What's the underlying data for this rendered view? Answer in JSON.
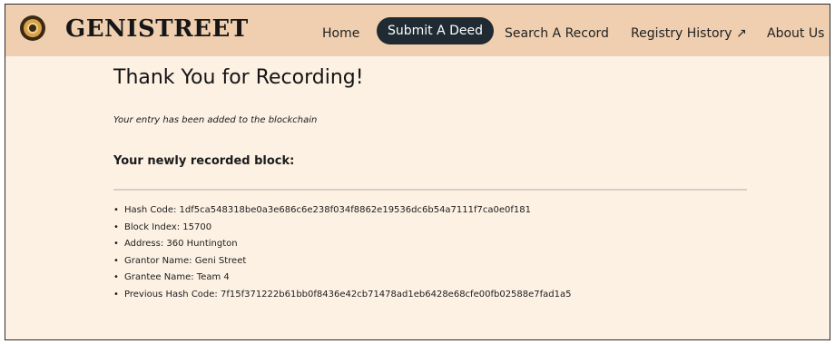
{
  "brand": {
    "name": "GENISTREET",
    "logo_icon": "seal-icon"
  },
  "nav": {
    "items": [
      {
        "label": "Home"
      },
      {
        "label": "Submit A Deed",
        "active": true
      },
      {
        "label": "Search A Record"
      },
      {
        "label": "Registry History ↗"
      },
      {
        "label": "About Us"
      }
    ]
  },
  "main": {
    "title": "Thank You for Recording!",
    "subtitle": "Your entry has been added to the blockchain",
    "section_heading": "Your newly recorded block:",
    "details": [
      "Hash Code: 1df5ca548318be0a3e686c6e238f034f8862e19536dc6b54a7111f7ca0e0f181",
      "Block Index: 15700",
      "Address: 360 Huntington",
      "Grantor Name: Geni Street",
      "Grantee Name: Team 4",
      "Previous Hash Code: 7f15f371222b61bb0f8436e42cb71478ad1eb6428e68cfe00fb02588e7fad1a5"
    ]
  },
  "colors": {
    "nav_background": "#efcfb0",
    "page_background": "#fdf1e4",
    "active_pill": "#1f2a33"
  }
}
